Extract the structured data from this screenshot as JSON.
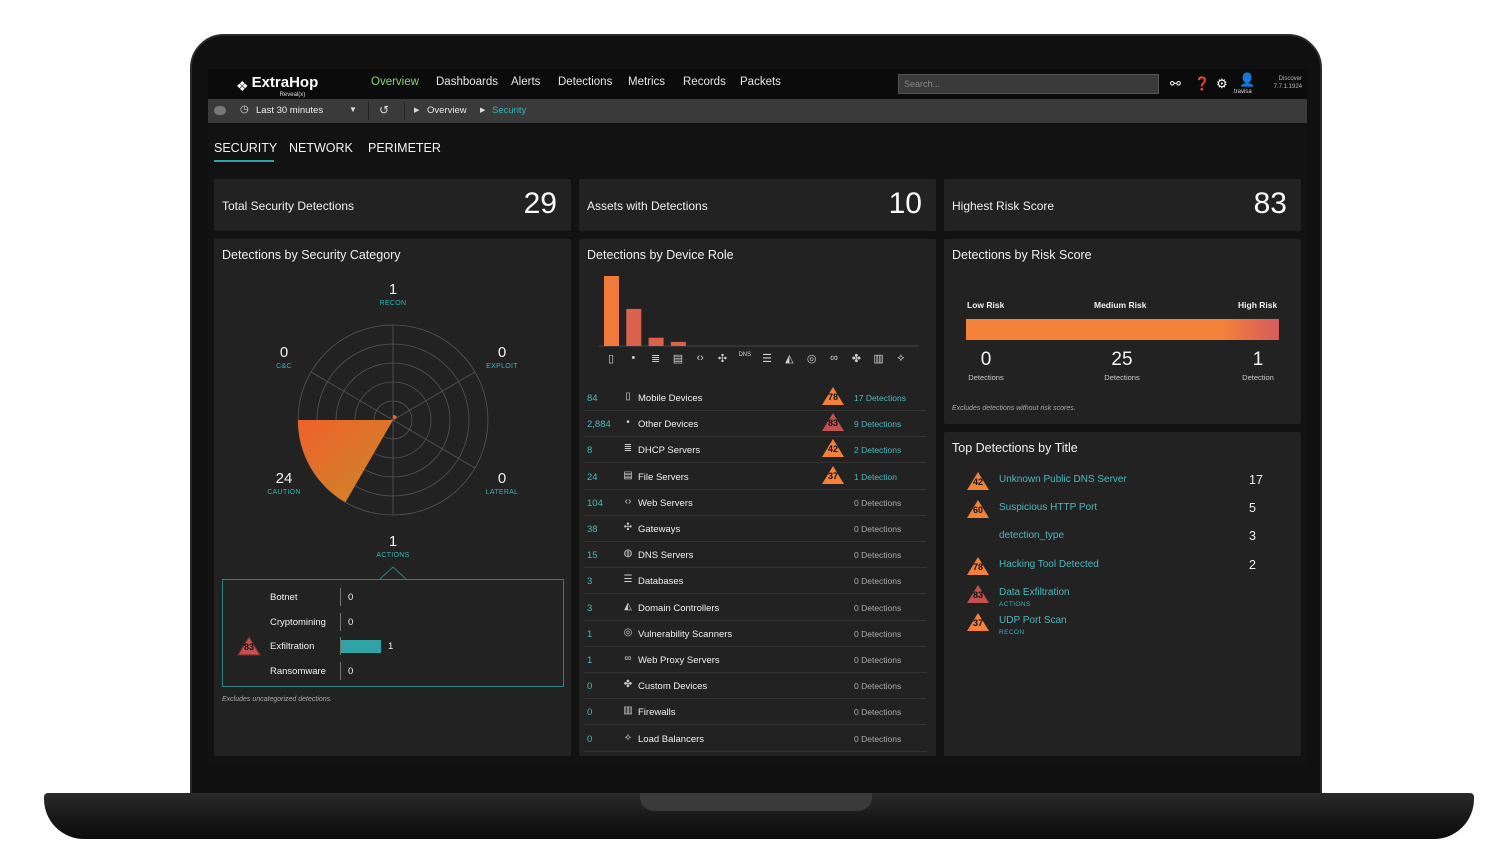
{
  "app": {
    "brand": "ExtraHop",
    "brand_sub": "Reveal(x)",
    "nav": [
      "Overview",
      "Dashboards",
      "Alerts",
      "Detections",
      "Metrics",
      "Records",
      "Packets"
    ],
    "search_placeholder": "Search...",
    "user": "travisa",
    "version_line1": "Discover",
    "version_line2": "7.7.1.1924"
  },
  "toolbar": {
    "time_range": "Last 30 minutes",
    "breadcrumb": [
      "Overview",
      "Security"
    ]
  },
  "tabs": [
    "SECURITY",
    "NETWORK",
    "PERIMETER"
  ],
  "kpis": [
    {
      "label": "Total Security Detections",
      "value": "29"
    },
    {
      "label": "Assets with Detections",
      "value": "10"
    },
    {
      "label": "Highest Risk Score",
      "value": "83"
    }
  ],
  "category_panel": {
    "title": "Detections by Security Category",
    "radar": [
      {
        "label": "RECON",
        "value": "1"
      },
      {
        "label": "EXPLOIT",
        "value": "0"
      },
      {
        "label": "LATERAL",
        "value": "0"
      },
      {
        "label": "ACTIONS",
        "value": "1"
      },
      {
        "label": "CAUTION",
        "value": "24"
      },
      {
        "label": "C&C",
        "value": "0"
      }
    ],
    "breakdown": [
      {
        "name": "Botnet",
        "value": "0",
        "risk": ""
      },
      {
        "name": "Cryptomining",
        "value": "0",
        "risk": ""
      },
      {
        "name": "Exfiltration",
        "value": "1",
        "risk": "83"
      },
      {
        "name": "Ransomware",
        "value": "0",
        "risk": ""
      }
    ],
    "note": "Excludes uncategorized detections."
  },
  "role_panel": {
    "title": "Detections by Device Role",
    "bar_values": [
      17,
      9,
      2,
      1,
      0,
      0,
      0,
      0,
      0,
      0,
      0,
      0,
      0,
      0
    ],
    "axis_icons": [
      "▯",
      "•",
      "≣",
      "▤",
      "‹›",
      "✣",
      "DNS",
      "☰",
      "◭",
      "◎",
      "∞",
      "✤",
      "▥",
      "⟡"
    ],
    "rows": [
      {
        "count": "84",
        "icon": "▯",
        "name": "Mobile Devices",
        "risk": "78",
        "detections": "17 Detections"
      },
      {
        "count": "2,884",
        "icon": "•",
        "name": "Other Devices",
        "risk": "83",
        "detections": "9 Detections"
      },
      {
        "count": "8",
        "icon": "≣",
        "name": "DHCP Servers",
        "risk": "42",
        "detections": "2 Detections"
      },
      {
        "count": "24",
        "icon": "▤",
        "name": "File Servers",
        "risk": "37",
        "detections": "1 Detection"
      },
      {
        "count": "104",
        "icon": "‹›",
        "name": "Web Servers",
        "risk": "",
        "detections": "0 Detections"
      },
      {
        "count": "38",
        "icon": "✣",
        "name": "Gateways",
        "risk": "",
        "detections": "0 Detections"
      },
      {
        "count": "15",
        "icon": "◍",
        "name": "DNS Servers",
        "risk": "",
        "detections": "0 Detections"
      },
      {
        "count": "3",
        "icon": "☰",
        "name": "Databases",
        "risk": "",
        "detections": "0 Detections"
      },
      {
        "count": "3",
        "icon": "◭",
        "name": "Domain Controllers",
        "risk": "",
        "detections": "0 Detections"
      },
      {
        "count": "1",
        "icon": "◎",
        "name": "Vulnerability Scanners",
        "risk": "",
        "detections": "0 Detections"
      },
      {
        "count": "1",
        "icon": "∞",
        "name": "Web Proxy Servers",
        "risk": "",
        "detections": "0 Detections"
      },
      {
        "count": "0",
        "icon": "✤",
        "name": "Custom Devices",
        "risk": "",
        "detections": "0 Detections"
      },
      {
        "count": "0",
        "icon": "▥",
        "name": "Firewalls",
        "risk": "",
        "detections": "0 Detections"
      },
      {
        "count": "0",
        "icon": "⟡",
        "name": "Load Balancers",
        "risk": "",
        "detections": "0 Detections"
      }
    ]
  },
  "risk_panel": {
    "title": "Detections by Risk Score",
    "levels": [
      {
        "label": "Low Risk",
        "value": "0",
        "sub": "Detections"
      },
      {
        "label": "Medium Risk",
        "value": "25",
        "sub": "Detections"
      },
      {
        "label": "High Risk",
        "value": "1",
        "sub": "Detection"
      }
    ],
    "note": "Excludes detections without risk scores."
  },
  "top_panel": {
    "title": "Top Detections by Title",
    "rows": [
      {
        "risk": "42",
        "title": "Unknown Public DNS Server",
        "sub": "",
        "value": "17"
      },
      {
        "risk": "60",
        "title": "Suspicious HTTP Port",
        "sub": "",
        "value": "5"
      },
      {
        "risk": "",
        "title": "detection_type",
        "sub": "",
        "value": "3"
      },
      {
        "risk": "78",
        "title": "Hacking Tool Detected",
        "sub": "",
        "value": "2"
      },
      {
        "risk": "83",
        "title": "Data Exfiltration",
        "sub": "ACTIONS",
        "value": ""
      },
      {
        "risk": "37",
        "title": "UDP Port Scan",
        "sub": "RECON",
        "value": ""
      }
    ]
  },
  "colors": {
    "accent": "#2fa3a6",
    "nav_active": "#8fd16c",
    "medium_risk": "#f4813a",
    "high_risk": "#c2514f"
  }
}
